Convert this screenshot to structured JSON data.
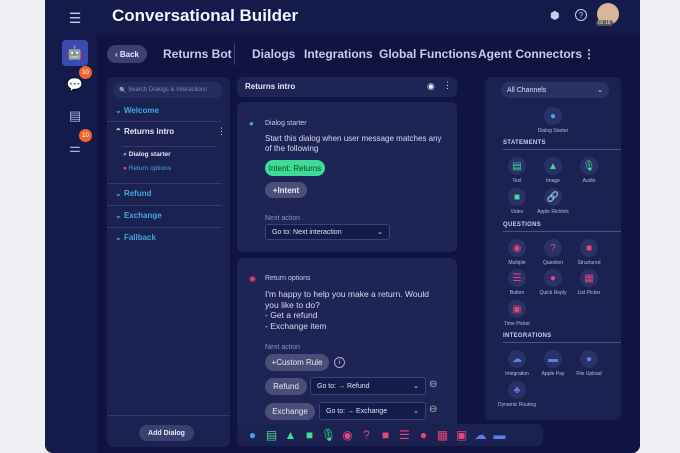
{
  "header": {
    "title": "Conversational Builder",
    "avatar_time": "02:18"
  },
  "rail": {
    "badge_1": "10",
    "badge_2": "10"
  },
  "nav": {
    "back": "Back",
    "bot_name": "Returns Bot",
    "tabs": [
      "Dialogs",
      "Integrations",
      "Global Functions",
      "Agent Connectors"
    ]
  },
  "sidebar": {
    "search_placeholder": "Search Dialogs & Interactions",
    "items": [
      {
        "label": "Welcome"
      },
      {
        "label": "Returns intro",
        "children": [
          "Dialog starter",
          "Return options"
        ]
      },
      {
        "label": "Refund"
      },
      {
        "label": "Exchange"
      },
      {
        "label": "Fallback"
      }
    ],
    "add_dialog": "Add Dialog"
  },
  "canvas": {
    "title": "Returns intro",
    "starter": {
      "label": "Dialog starter",
      "text": "Start this dialog when user message matches any of the following",
      "intent": "Intent: Returns",
      "add_intent": "+Intent",
      "next_action_label": "Next action",
      "next_action": "Go to: Next interaction"
    },
    "options": {
      "label": "Return options",
      "text_lines": [
        "I'm happy to help you make a return. Would you like to do?",
        "- Get a refund",
        "- Exchange item"
      ],
      "next_action_label": "Next action",
      "custom_rule": "+Custom Rule",
      "rules": [
        {
          "label": "Refund",
          "goto": "Go to: → Refund"
        },
        {
          "label": "Exchange",
          "goto": "Go to: → Exchange"
        }
      ]
    }
  },
  "palette": {
    "channel": "All Channels",
    "starter": "Dialog Starter",
    "sections": [
      {
        "title": "STATEMENTS",
        "tools": [
          "Text",
          "Image",
          "Audio",
          "Video",
          "Apple Richlink"
        ]
      },
      {
        "title": "QUESTIONS",
        "tools": [
          "Multiple",
          "Question",
          "Structured",
          "Button",
          "Quick Reply",
          "List Picker",
          "Time Picker"
        ]
      },
      {
        "title": "INTEGRATIONS",
        "tools": [
          "Integration",
          "Apple Pay",
          "File Upload",
          "Dynamic Routing"
        ]
      }
    ]
  },
  "colors": {
    "accent": "#3fa9e0",
    "intent": "#3ddc97",
    "statement": "#3ddc97",
    "question": "#e8457a",
    "integration": "#5b7fe8"
  }
}
